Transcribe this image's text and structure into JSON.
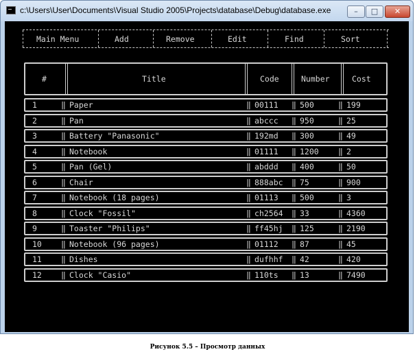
{
  "window": {
    "title": "c:\\Users\\User\\Documents\\Visual Studio 2005\\Projects\\database\\Debug\\database.exe",
    "controls": {
      "minimize": "–",
      "maximize": "□",
      "close": "✕"
    }
  },
  "menu": {
    "items": [
      "Main Menu",
      "Add",
      "Remove",
      "Edit",
      "Find",
      "Sort"
    ]
  },
  "table": {
    "headers": [
      "#",
      "Title",
      "Code",
      "Number",
      "Cost"
    ],
    "rows": [
      [
        "1",
        "Paper",
        "00111",
        "500",
        "199"
      ],
      [
        "2",
        "Pan",
        "abccc",
        "950",
        "25"
      ],
      [
        "3",
        "Battery \"Panasonic\"",
        "192md",
        "300",
        "49"
      ],
      [
        "4",
        "Notebook",
        "01111",
        "1200",
        "2"
      ],
      [
        "5",
        "Pan (Gel)",
        "abddd",
        "400",
        "50"
      ],
      [
        "6",
        "Chair",
        "888abc",
        "75",
        "900"
      ],
      [
        "7",
        "Notebook (18 pages)",
        "01113",
        "500",
        "3"
      ],
      [
        "8",
        "Clock \"Fossil\"",
        "ch2564",
        "33",
        "4360"
      ],
      [
        "9",
        "Toaster \"Philips\"",
        "ff45hj",
        "125",
        "2190"
      ],
      [
        "10",
        "Notebook (96 pages)",
        "01112",
        "87",
        "45"
      ],
      [
        "11",
        "Dishes",
        "dufhhf",
        "42",
        "420"
      ],
      [
        "12",
        "Clock \"Casio\"",
        "110ts",
        "13",
        "7490"
      ]
    ]
  },
  "caption": "Рисунок 5.5 – Просмотр данных"
}
